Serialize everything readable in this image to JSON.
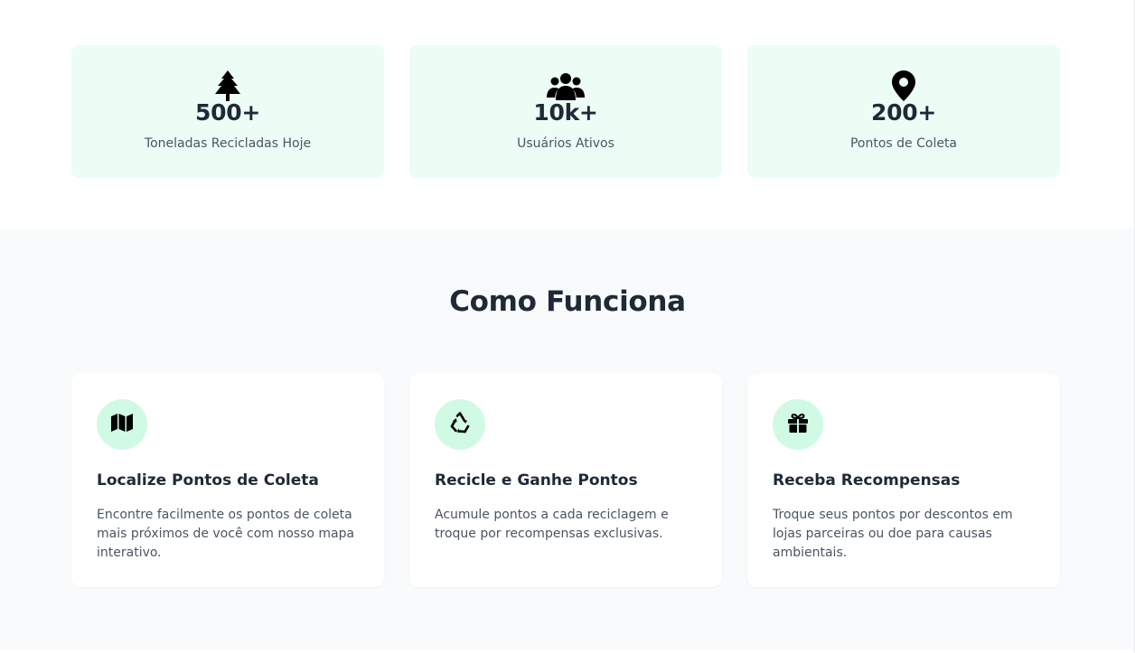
{
  "stats": [
    {
      "icon": "tree-icon",
      "value": "500+",
      "label": "Toneladas Recicladas Hoje"
    },
    {
      "icon": "users-icon",
      "value": "10k+",
      "label": "Usuários Ativos"
    },
    {
      "icon": "map-pin-icon",
      "value": "200+",
      "label": "Pontos de Coleta"
    }
  ],
  "how": {
    "title": "Como Funciona",
    "features": [
      {
        "icon": "map-icon",
        "title": "Localize Pontos de Coleta",
        "desc": "Encontre facilmente os pontos de coleta mais próximos de você com nosso mapa interativo."
      },
      {
        "icon": "recycle-icon",
        "title": "Recicle e Ganhe Pontos",
        "desc": "Acumule pontos a cada reciclagem e troque por recompensas exclusivas."
      },
      {
        "icon": "gift-icon",
        "title": "Receba Recompensas",
        "desc": "Troque seus pontos por descontos em lojas parceiras ou doe para causas ambientais."
      }
    ]
  },
  "colors": {
    "stat_card_bg": "#ecfdf5",
    "icon_circle_bg": "#d1fae5",
    "section_bg": "#f9fafb",
    "heading": "#1f2937",
    "body_text": "#4b5563"
  }
}
